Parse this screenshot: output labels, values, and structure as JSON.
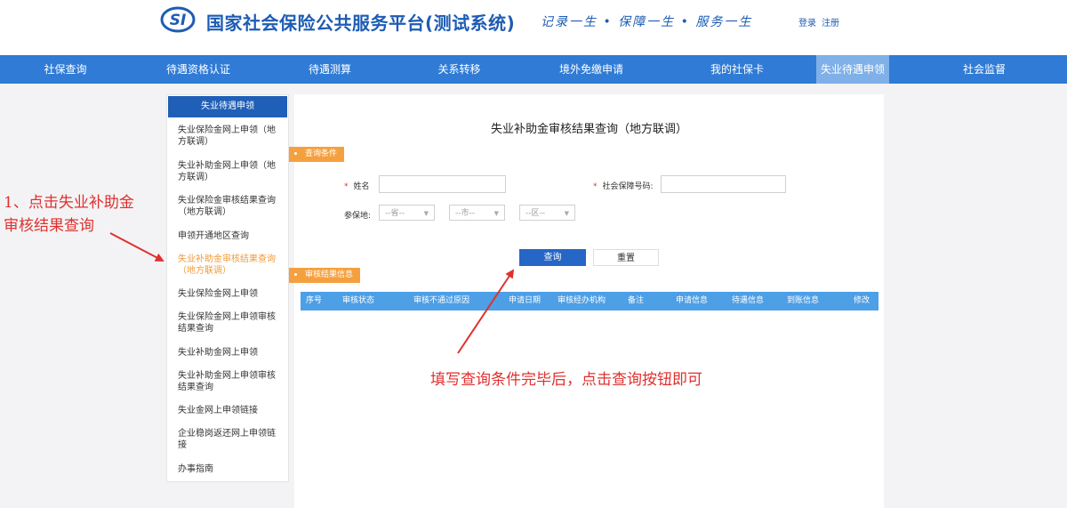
{
  "header": {
    "logo_text": "SI",
    "site_title": "国家社会保险公共服务平台(测试系统)",
    "slogan": "记录一生 • 保障一生 • 服务一生",
    "login": "登录",
    "register": "注册"
  },
  "nav": [
    "社保查询",
    "待遇资格认证",
    "待遇测算",
    "关系转移",
    "境外免缴申请",
    "我的社保卡",
    "失业待遇申领",
    "社会监督"
  ],
  "sidebar": {
    "title": "失业待遇申领",
    "items": [
      "失业保险金网上申领（地方联调）",
      "失业补助金网上申领（地方联调）",
      "失业保险金审核结果查询（地方联调）",
      "申领开通地区查询",
      "失业补助金审核结果查询（地方联调）",
      "失业保险金网上申领",
      "失业保险金网上申领审核结果查询",
      "失业补助金网上申领",
      "失业补助金网上申领审核结果查询",
      "失业金网上申领链接",
      "企业稳岗返还网上申领链接",
      "办事指南"
    ]
  },
  "main": {
    "title": "失业补助金审核结果查询（地方联调）",
    "query_tag": "查询条件",
    "name_label": "姓名",
    "ssn_label": "社会保障号码:",
    "region_label": "参保地:",
    "province_placeholder": "--省--",
    "city_placeholder": "--市--",
    "district_placeholder": "--区--",
    "query_button": "查询",
    "reset_button": "重置",
    "result_tag": "审核结果信息",
    "columns": [
      "序号",
      "审核状态",
      "审核不通过原因",
      "申请日期",
      "审核经办机构",
      "备注",
      "申请信息",
      "待遇信息",
      "到账信息",
      "修改"
    ]
  },
  "annotations": {
    "step1": [
      "1、点击失业补助金",
      "审核结果查询"
    ],
    "step2": "填写查询条件完毕后，点击查询按钮即可"
  },
  "colors": {
    "brand": "#1e5cb3",
    "nav_bg": "#2f7bd6",
    "nav_active": "#7fb0e8",
    "tag": "#f5a03e",
    "annotation": "#e0302e",
    "table_head": "#4d9fe6"
  }
}
